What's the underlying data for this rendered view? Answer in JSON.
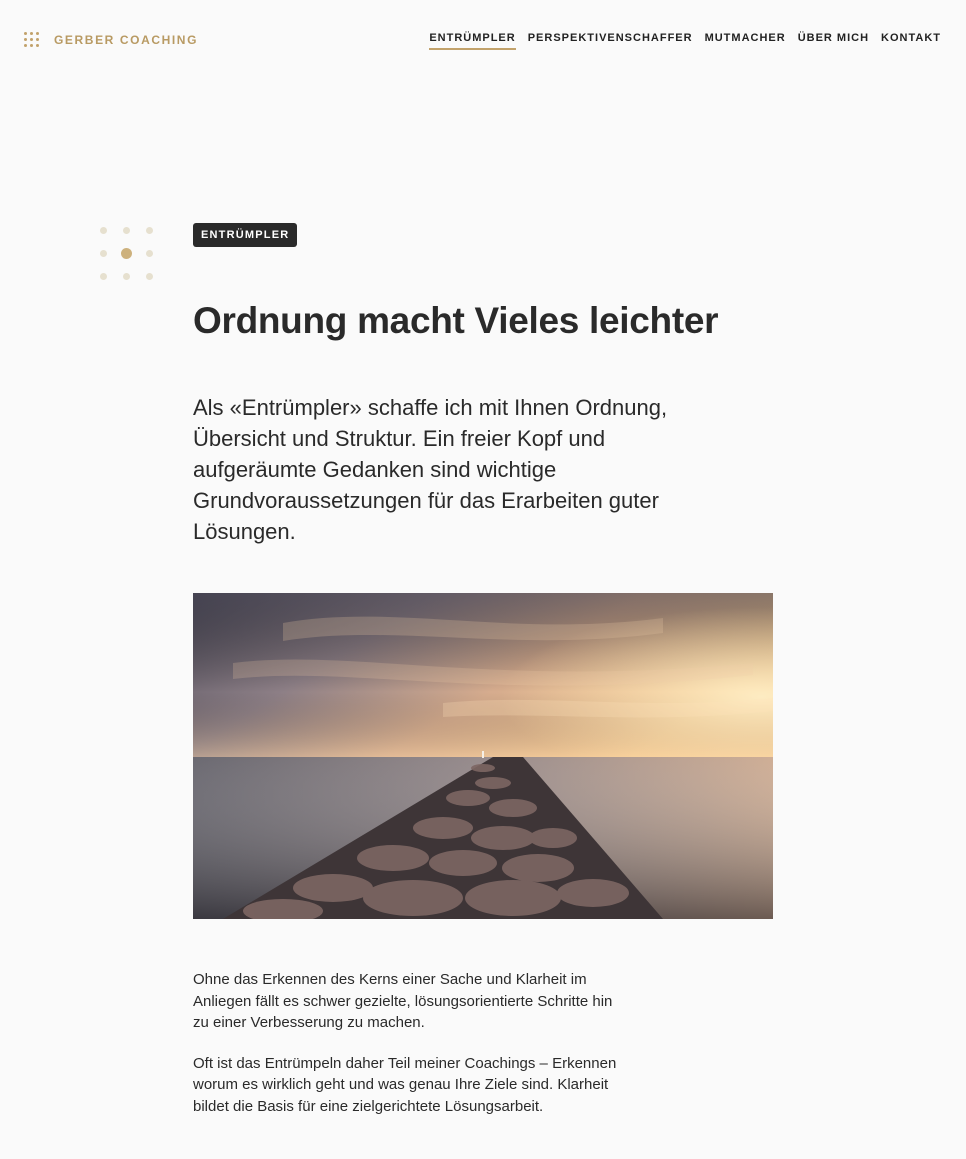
{
  "header": {
    "logo_text": "GERBER COACHING",
    "nav": [
      {
        "label": "ENTRÜMPLER",
        "active": true
      },
      {
        "label": "PERSPEKTIVENSCHAFFER",
        "active": false
      },
      {
        "label": "MUTMACHER",
        "active": false
      },
      {
        "label": "ÜBER MICH",
        "active": false
      },
      {
        "label": "KONTAKT",
        "active": false
      }
    ]
  },
  "main": {
    "tag": "ENTRÜMPLER",
    "title": "Ordnung macht Vieles leichter",
    "lead": "Als «Entrümpler» schaffe ich mit Ihnen Ordnung, Übersicht und Struktur. Ein freier Kopf und aufgeräumte Gedanken sind wichtige Grundvoraussetzungen für das Erarbeiten guter Lösungen.",
    "paragraphs": [
      "Ohne das Erkennen des Kerns einer Sache und Klarheit im Anliegen fällt es schwer gezielte, lösungsorientierte Schritte hin zu einer Verbesserung zu machen.",
      "Oft ist das Entrümpeln daher Teil meiner Coachings – Erkennen worum es wirklich geht und was genau Ihre Ziele sind. Klarheit bildet die Basis für eine zielgerichtete Lösungsarbeit."
    ]
  },
  "colors": {
    "accent": "#c2a26b",
    "text": "#2a2a2a",
    "background": "#fafafa",
    "tag_bg": "#2a2a2a"
  }
}
